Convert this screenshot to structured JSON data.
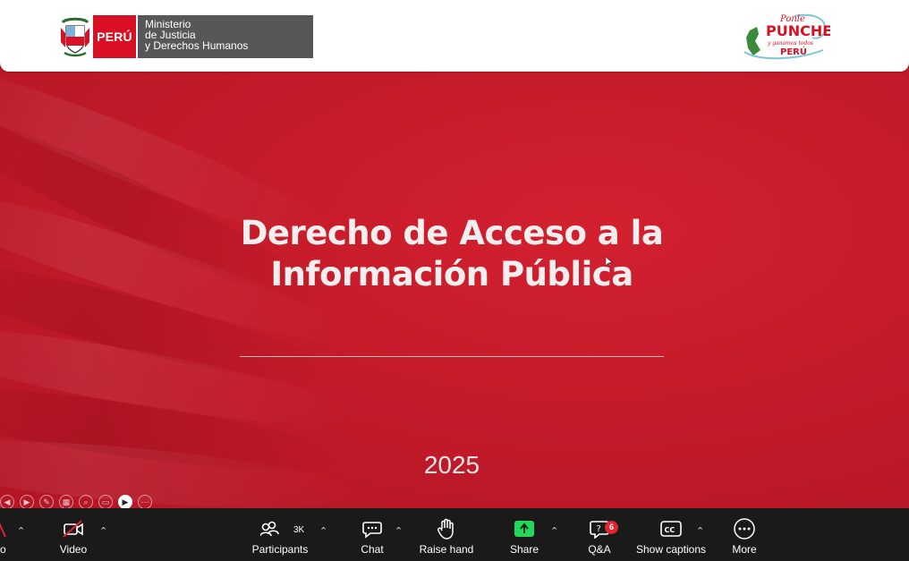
{
  "slide": {
    "ministry_badge": "PERÚ",
    "ministry_lines": [
      "Ministerio",
      "de Justicia",
      "y Derechos Humanos"
    ],
    "title_lines": [
      "Derecho de Acceso a la",
      "Información Pública"
    ],
    "year": "2025",
    "campaign_logo": {
      "top": "Ponle",
      "main": "PUNCHE",
      "tagline": "y ganamos todos",
      "bottom": "PERÚ"
    }
  },
  "toolbar": {
    "audio_label": "io",
    "video_label": "Video",
    "participants_label": "Participants",
    "participants_count": "3K",
    "chat_label": "Chat",
    "raise_hand_label": "Raise hand",
    "share_label": "Share",
    "qa_label": "Q&A",
    "qa_badge": "6",
    "captions_label": "Show captions",
    "more_label": "More"
  },
  "colors": {
    "slide_red": "#c41b2a",
    "peru_red": "#d91023",
    "share_green": "#23d959",
    "toolbar_bg": "#1a1a1a",
    "badge_red": "#e0252f"
  },
  "icons": [
    "coat-of-arms-icon",
    "video-off-icon",
    "participants-icon",
    "chat-icon",
    "raise-hand-icon",
    "share-icon",
    "qa-icon",
    "captions-icon",
    "more-icon",
    "chevron-up-icon"
  ]
}
